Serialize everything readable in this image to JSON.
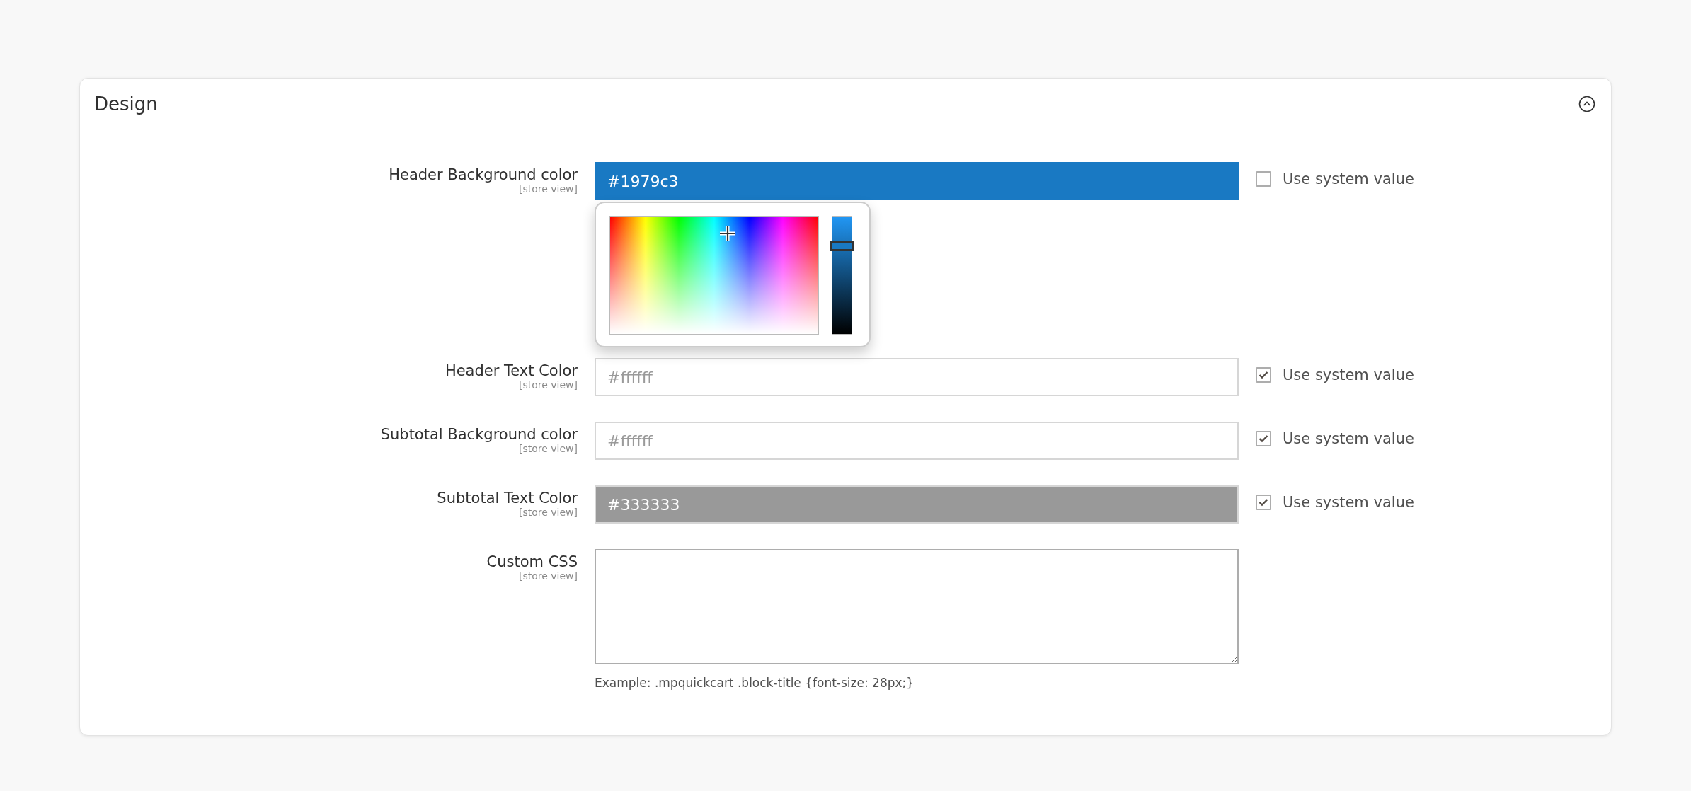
{
  "section": {
    "title": "Design",
    "expanded": true
  },
  "fields": [
    {
      "kind": "color",
      "label": "Header Background color",
      "scope": "[store view]",
      "value": "#1979c3",
      "color": "#1979c3",
      "disabled": false,
      "use_system_value": {
        "label": "Use system value",
        "checked": false
      },
      "picker": {
        "open": true,
        "level": 0.76
      }
    },
    {
      "kind": "color",
      "label": "Header Text Color",
      "scope": "[store view]",
      "value": "#ffffff",
      "color": "#ffffff",
      "disabled": true,
      "use_system_value": {
        "label": "Use system value",
        "checked": true
      }
    },
    {
      "kind": "color",
      "label": "Subtotal Background color",
      "scope": "[store view]",
      "value": "#ffffff",
      "color": "#ffffff",
      "disabled": true,
      "use_system_value": {
        "label": "Use system value",
        "checked": true
      }
    },
    {
      "kind": "color",
      "label": "Subtotal Text Color",
      "scope": "[store view]",
      "value": "#333333",
      "color": "#999999",
      "disabled": true,
      "use_system_value": {
        "label": "Use system value",
        "checked": true
      }
    },
    {
      "kind": "textarea",
      "label": "Custom CSS",
      "scope": "[store view]",
      "note": "Example: .mpquickcart .block-title {font-size: 28px;}"
    }
  ]
}
